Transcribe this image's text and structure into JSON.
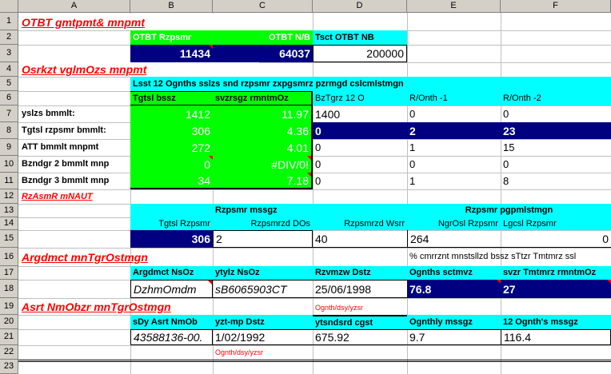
{
  "columns": [
    "A",
    "B",
    "C",
    "D",
    "E",
    "F"
  ],
  "rows": [
    "1",
    "2",
    "3",
    "4",
    "5",
    "6",
    "7",
    "8",
    "9",
    "10",
    "11",
    "12",
    "13",
    "14",
    "15",
    "16",
    "17",
    "18",
    "19",
    "20",
    "21",
    "22",
    "23"
  ],
  "s1": {
    "title": "OTBT gmtpmt& mnpmt",
    "h1": "OTBT Rzpsmr",
    "h2": "OTBT N/B",
    "h3": "Tsct OTBT  NB",
    "v1": "11434",
    "v2": "64037",
    "v3": "200000"
  },
  "s2": {
    "title": "Osrkzt vglmOzs mnpmt",
    "banner": "Lsst 12 Ognths sslzs snd rzpsmr zxpgsmrz pzrmgd cslcmlstmgn",
    "col_b": "Tgtsl bssz",
    "col_c": "svzrsgz rmntmOz",
    "col_d": "BzTgrz 12 O",
    "col_e": "R/Onth -1",
    "col_f": "R/Onth -2",
    "rows": [
      {
        "label": "yslzs bmmlt:",
        "b": "1412",
        "c": "11.97",
        "d": "1400",
        "e": "0",
        "f": "0"
      },
      {
        "label": "Tgtsl rzpsmr bmmlt:",
        "b": "306",
        "c": "4.36",
        "d": "0",
        "e": "2",
        "f": "23"
      },
      {
        "label": "ATT bmmlt mnpmt",
        "b": "272",
        "c": "4.01",
        "d": "0",
        "e": "1",
        "f": "15"
      },
      {
        "label": "Bzndgr 2 bmmlt mnp",
        "b": "0",
        "c": "#DIV/0!",
        "d": "0",
        "e": "0",
        "f": "0"
      },
      {
        "label": "Bzndgr 3 bmmlt mnp",
        "b": "34",
        "c": "7.18",
        "d": "0",
        "e": "1",
        "f": "8"
      }
    ]
  },
  "s3": {
    "title": "RzAsmR mNAUT",
    "h_c": "Rzpsmr mssgz",
    "h_ef": "Rzpsmr pgpmlstmgn",
    "sub_b": "Tgtsl Rzpsmr",
    "sub_c": "Rzpsmrzd DOs",
    "sub_d": "Rzpsmrzd Wsrr",
    "sub_e": "NgrOsl Rzpsmr",
    "sub_f": "Lgcsl Rzpsmr",
    "v_b": "306",
    "v_c": "2",
    "v_d": "40",
    "v_e": "264",
    "v_f": "0"
  },
  "s4": {
    "title": "Argdmct mnTgrOstmgn",
    "note": "% cmrrznt mnstsllzd bssz sTtzr Tmtmrz ssl",
    "h_b": "Argdmct NsOz",
    "h_c": "ytylz NsOz",
    "h_d": "Rzvmzw Dstz",
    "h_e": "Ognths sctmvz",
    "h_f": "svzr Tmtmrz rmntmOz",
    "v_b": "DzhmOmdm",
    "v_c": "sB6065903CT",
    "v_d": "25/06/1998",
    "v_e": "76.8",
    "v_f": "27",
    "fmt": "Ognth/dsy/yzsr"
  },
  "s5": {
    "title": "Asrt NmObzr mnTgrOstmgn",
    "h_b": "sDy Asrt NmOb",
    "h_c": "yzt-mp Dstz",
    "h_d": "ytsndsrd cgst",
    "h_e": "Ognthly mssgz",
    "h_f": "12 Ognth's mssgz",
    "v_b": "43588136-00.",
    "v_c": "1/02/1992",
    "v_d": "675.92",
    "v_e": "9.7",
    "v_f": "116.4",
    "fmt": "Ognth/dsy/yzsr"
  }
}
